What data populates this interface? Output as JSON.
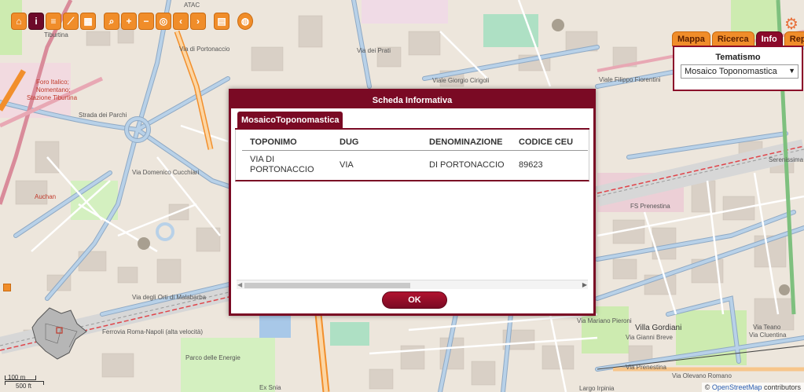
{
  "toolbar": {
    "tools": [
      {
        "icon": "home-icon",
        "glyph": "⌂"
      },
      {
        "icon": "info-icon",
        "glyph": "i"
      },
      {
        "icon": "layers-icon",
        "glyph": "≡"
      },
      {
        "icon": "measure-icon",
        "glyph": "⟋"
      },
      {
        "icon": "grid-icon",
        "glyph": "▦"
      },
      {
        "icon": "zoom-box-icon",
        "glyph": "⌕"
      },
      {
        "icon": "zoom-in-icon",
        "glyph": "+"
      },
      {
        "icon": "zoom-out-icon",
        "glyph": "−"
      },
      {
        "icon": "zoom-extent-icon",
        "glyph": "◎"
      },
      {
        "icon": "back-icon",
        "glyph": "‹"
      },
      {
        "icon": "forward-icon",
        "glyph": "›"
      },
      {
        "icon": "print-icon",
        "glyph": "▤"
      },
      {
        "icon": "globe-icon",
        "glyph": "◍"
      }
    ]
  },
  "right_panel": {
    "tabs": [
      "Mappa",
      "Ricerca",
      "Info",
      "Report"
    ],
    "active_tab": "Info",
    "tematismo_label": "Tematismo",
    "tematismo_value": "Mosaico Toponomastica"
  },
  "dialog": {
    "title": "Scheda Informativa",
    "tab_label": "MosaicoToponomastica",
    "columns": [
      "TOPONIMO",
      "DUG",
      "DENOMINAZIONE",
      "CODICE CEU"
    ],
    "rows": [
      {
        "toponimo_line1": "VIA DI",
        "toponimo_line2": "PORTONACCIO",
        "dug": "VIA",
        "denominazione": "DI PORTONACCIO",
        "codice_ceu": "89623"
      }
    ],
    "ok_label": "OK"
  },
  "map": {
    "labels": [
      "Strada dei Parchi",
      "Auchan",
      "Via Domenico Cucchiari",
      "Viale Giorgio Cirigoli",
      "Viale Filippo Fiorentini",
      "Via di Portonaccio",
      "FS Prenestina",
      "Villa Gordiani",
      "Parco delle Energie",
      "Ex Snia",
      "Via degli Orti di Malabarba",
      "Ferrovia Roma-Napoli (alta velocità)",
      "Via Prenestina",
      "Via Olevano Romano",
      "Serenissima",
      "ATAC",
      "Tiburtina",
      "Via Teano",
      "Via Cluentina",
      "Largo Irpinia",
      "Via Gianni Breve",
      "Via Mariano Pieroni"
    ],
    "label_fragments": [
      "Foro Italico;",
      "Nomentano;",
      "Stazione Tiburtina",
      "Via dei Prati"
    ]
  },
  "scale": {
    "top": "100 m",
    "bottom": "500 ft"
  },
  "attribution": {
    "prefix": "© ",
    "link": "OpenStreetMap",
    "suffix": " contributors"
  },
  "colors": {
    "accent": "#7a0a24",
    "tool_orange": "#f08d2a",
    "park_green": "#cdebb0",
    "road_blue": "#b8d1e8",
    "motorway_orange": "#f28f2c"
  }
}
